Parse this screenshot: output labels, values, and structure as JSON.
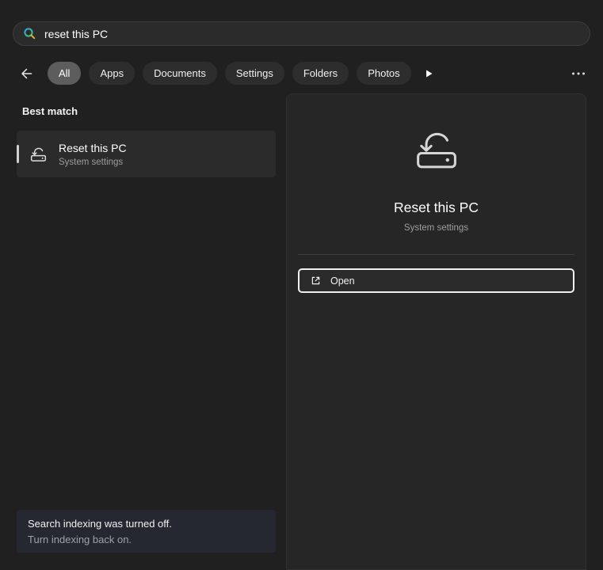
{
  "search": {
    "value": "reset this PC",
    "icon": "search-icon"
  },
  "toolbar": {
    "filters": [
      {
        "label": "All",
        "selected": true
      },
      {
        "label": "Apps",
        "selected": false
      },
      {
        "label": "Documents",
        "selected": false
      },
      {
        "label": "Settings",
        "selected": false
      },
      {
        "label": "Folders",
        "selected": false
      },
      {
        "label": "Photos",
        "selected": false
      }
    ],
    "icons": {
      "back": "arrow-left-icon",
      "more_filters": "play-triangle-icon",
      "more_options": "ellipsis-icon"
    }
  },
  "results": {
    "section_title": "Best match",
    "best_match": {
      "title": "Reset this PC",
      "subtitle": "System settings",
      "icon": "reset-pc-icon"
    }
  },
  "preview": {
    "title": "Reset this PC",
    "subtitle": "System settings",
    "icon": "reset-pc-icon",
    "open_label": "Open",
    "open_icon": "external-link-icon"
  },
  "notice": {
    "message": "Search indexing was turned off.",
    "action": "Turn indexing back on."
  },
  "colors": {
    "background": "#202020",
    "selected_pill": "#5d5d5d",
    "accent_bar": "#d0d0d0",
    "panel": "#262626",
    "notice_bg": "#252830"
  }
}
